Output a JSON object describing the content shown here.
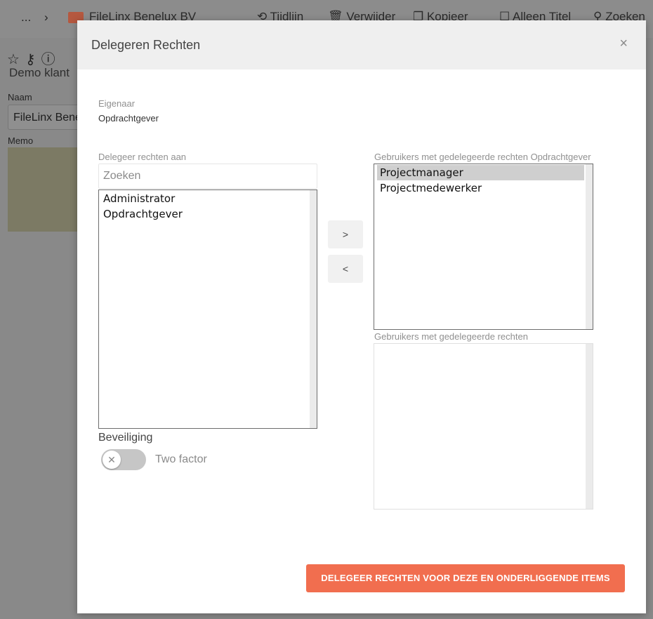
{
  "background": {
    "breadcrumb_more": "...",
    "breadcrumb_sep": "›",
    "breadcrumb_current": "FileLinx Benelux BV",
    "toolbar": {
      "timeline": "Tijdlijn",
      "delete": "Verwijder",
      "copy": "Kopieer",
      "title_only": "Alleen Titel",
      "search": "Zoeken"
    },
    "record_type": "Demo klant",
    "name_label": "Naam",
    "name_value": "FileLinx Benelux BV",
    "memo_label": "Memo"
  },
  "modal": {
    "title": "Delegeren Rechten",
    "close": "×",
    "owner_label": "Eigenaar",
    "owner_value": "Opdrachtgever",
    "delegate_label": "Delegeer rechten aan",
    "search_placeholder": "Zoeken",
    "available_users": [
      "Administrator",
      "Opdrachtgever"
    ],
    "delegated_owner_label": "Gebruikers met gedelegeerde rechten Opdrachtgever",
    "delegated_owner_users": [
      "Projectmanager",
      "Projectmedewerker"
    ],
    "delegated_label": "Gebruikers met gedelegeerde rechten",
    "delegated_users": [],
    "add_button": ">",
    "remove_button": "<",
    "security_title": "Beveiliging",
    "two_factor_label": "Two factor",
    "two_factor_enabled": false,
    "submit_button": "DELEGEER RECHTEN VOOR DEZE EN ONDERLIGGENDE ITEMS"
  },
  "colors": {
    "accent": "#f16e4f",
    "header_bg": "#efefef",
    "selected_bg": "#cfcfcf"
  }
}
